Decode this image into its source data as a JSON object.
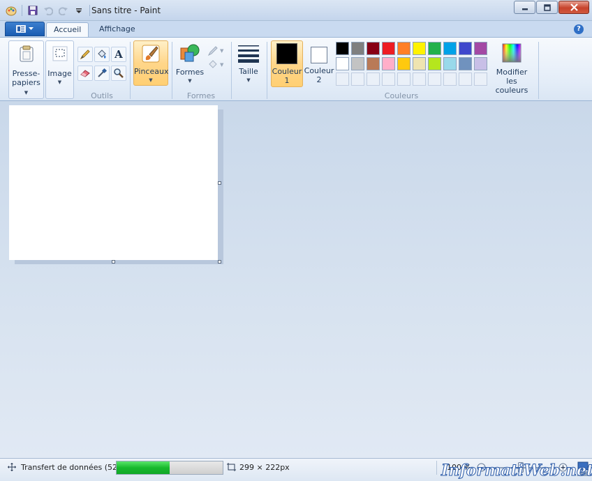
{
  "window": {
    "title": "Sans titre - Paint"
  },
  "tabs": [
    {
      "label": "Accueil",
      "active": true
    },
    {
      "label": "Affichage",
      "active": false
    }
  ],
  "help": "?",
  "ribbon": {
    "clipboard": {
      "line1": "Presse-",
      "line2": "papiers"
    },
    "image": {
      "label": "Image"
    },
    "tools_group": "Outils",
    "brushes": {
      "label": "Pinceaux"
    },
    "shapes": {
      "label": "Formes",
      "group": "Formes"
    },
    "size": {
      "label": "Taille"
    },
    "color1": {
      "line1": "Couleur",
      "line2": "1",
      "value": "#000000"
    },
    "color2": {
      "line1": "Couleur",
      "line2": "2",
      "value": "#ffffff"
    },
    "colors_group": "Couleurs",
    "edit_colors": {
      "line1": "Modifier les",
      "line2": "couleurs"
    },
    "palette_row1": [
      "#000000",
      "#7f7f7f",
      "#880015",
      "#ed1c24",
      "#ff7f27",
      "#fff200",
      "#22b14c",
      "#00a2e8",
      "#3f48cc",
      "#a349a4"
    ],
    "palette_row2": [
      "#ffffff",
      "#c3c3c3",
      "#b97a57",
      "#ffaec9",
      "#ffc90e",
      "#efe4b0",
      "#b5e61d",
      "#99d9ea",
      "#7092be",
      "#c8bfe7"
    ]
  },
  "status": {
    "transfer": "Transfert de données (52",
    "progress_percent": 50,
    "dimensions": "299 × 222px",
    "zoom": "100 %",
    "watermark": "InformatiWeb.net"
  },
  "colors": {
    "accent": "#1a5cb2",
    "progress": "#17b92d"
  }
}
